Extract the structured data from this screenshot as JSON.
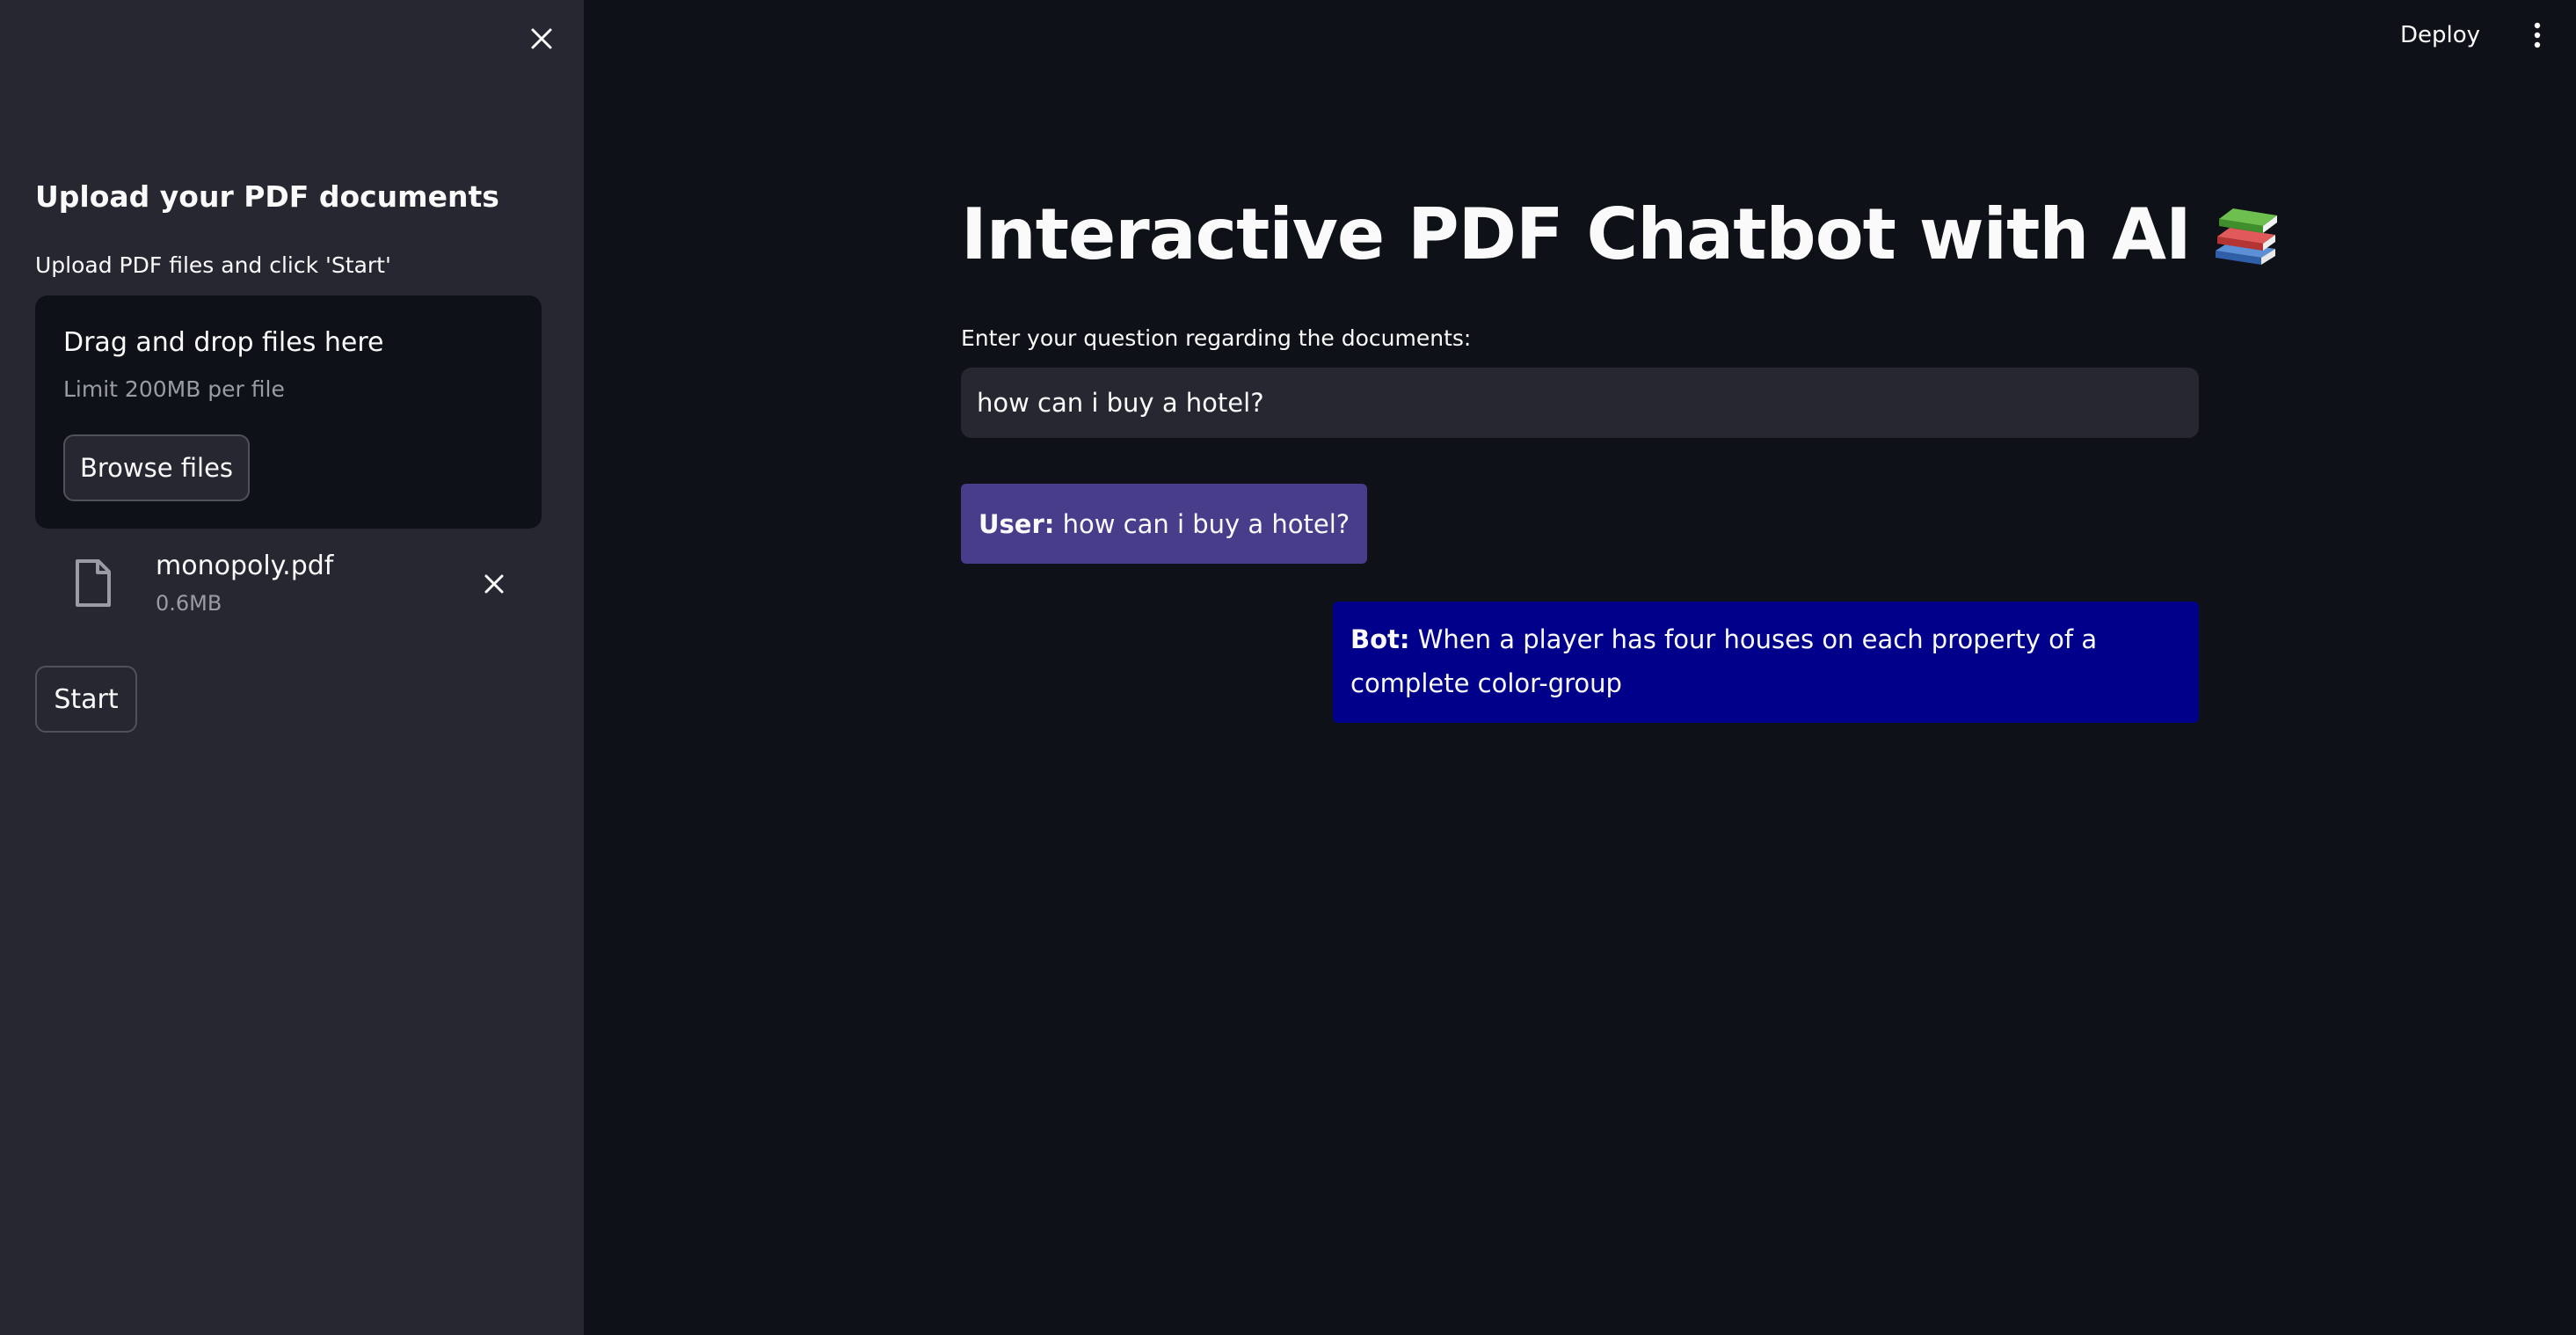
{
  "sidebar": {
    "heading": "Upload your PDF documents",
    "subtext": "Upload PDF files and click 'Start'",
    "dropzone": {
      "title": "Drag and drop files here",
      "limit": "Limit 200MB per file",
      "browse_label": "Browse files"
    },
    "uploaded_file": {
      "name": "monopoly.pdf",
      "size": "0.6MB",
      "icon": "file-icon"
    },
    "start_label": "Start",
    "close_icon": "close-icon"
  },
  "header": {
    "deploy_label": "Deploy",
    "menu_icon": "kebab-menu-icon"
  },
  "main": {
    "title": "Interactive PDF Chatbot with AI",
    "title_icon": "books-icon",
    "question_label": "Enter your question regarding the documents:",
    "question_value": "how can i buy a hotel?",
    "messages": [
      {
        "speaker": "User:",
        "text": "how can i buy a hotel?",
        "color": "#483d8b"
      },
      {
        "speaker": "Bot:",
        "text": "When a player has four houses on each property of a complete color-group",
        "color": "#00008b"
      }
    ]
  },
  "colors": {
    "background": "#0e1117",
    "sidebar": "#262730",
    "user_bubble": "#483d8b",
    "bot_bubble": "#00008b"
  }
}
